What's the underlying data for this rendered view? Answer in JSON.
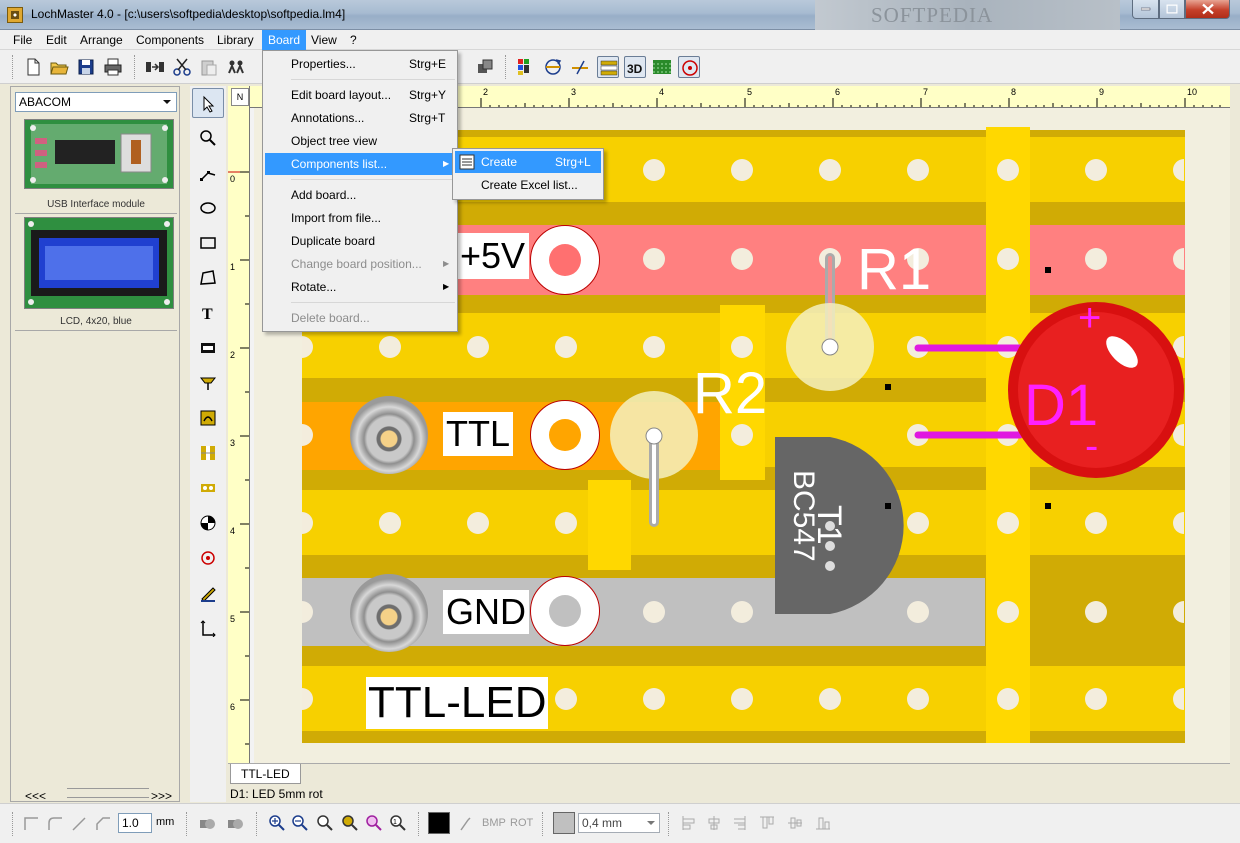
{
  "window": {
    "title": "LochMaster 4.0 - [c:\\users\\softpedia\\desktop\\softpedia.lm4]",
    "watermark": "SOFTPEDIA"
  },
  "menubar": {
    "items": [
      "File",
      "Edit",
      "Arrange",
      "Components",
      "Library",
      "Board",
      "View",
      "?"
    ],
    "active": "Board"
  },
  "board_menu": {
    "properties": {
      "label": "Properties...",
      "shortcut": "Strg+E"
    },
    "edit_layout": {
      "label": "Edit board layout...",
      "shortcut": "Strg+Y"
    },
    "annotations": {
      "label": "Annotations...",
      "shortcut": "Strg+T"
    },
    "object_tree": {
      "label": "Object tree view"
    },
    "components_list": {
      "label": "Components list..."
    },
    "add_board": {
      "label": "Add board..."
    },
    "import_file": {
      "label": "Import from file..."
    },
    "duplicate": {
      "label": "Duplicate board"
    },
    "change_position": {
      "label": "Change board position..."
    },
    "rotate": {
      "label": "Rotate..."
    },
    "delete": {
      "label": "Delete board..."
    }
  },
  "components_submenu": {
    "create": {
      "label": "Create",
      "shortcut": "Strg+L"
    },
    "excel": {
      "label": "Create Excel list..."
    }
  },
  "library": {
    "selected": "ABACOM",
    "items": [
      {
        "caption": "USB Interface module"
      },
      {
        "caption": "LCD, 4x20, blue"
      }
    ],
    "nav_prev": "<<<",
    "nav_next": ">>>"
  },
  "ruler": {
    "corner": "N",
    "h_ticks": [
      "2",
      "3",
      "4",
      "5",
      "6",
      "7",
      "8",
      "9",
      "10"
    ],
    "v_ticks": [
      "0",
      "1",
      "2",
      "3",
      "4",
      "5",
      "6"
    ]
  },
  "board": {
    "labels": {
      "plus5v": "+5V",
      "ttl": "TTL",
      "gnd": "GND",
      "title": "TTL-LED"
    },
    "refs": {
      "r1": "R1",
      "r2": "R2",
      "d1": "D1",
      "t1": "T1",
      "bc547": "BC547",
      "plus": "+",
      "minus": "-"
    },
    "colors": {
      "board": "#d0ab05",
      "strip_light": "#f7d000",
      "strip_plus": "#ff8080",
      "strip_ttl": "#ffa500",
      "strip_gnd": "#c0c0c0",
      "led": "#e01010",
      "lead": "#e018e0"
    }
  },
  "tabs": {
    "active": "TTL-LED"
  },
  "status": {
    "text": "D1: LED 5mm rot"
  },
  "bottombar": {
    "line_width": "1.0",
    "unit": "mm",
    "bmp": "BMP",
    "rot": "ROT",
    "grid": "0,4 mm"
  }
}
